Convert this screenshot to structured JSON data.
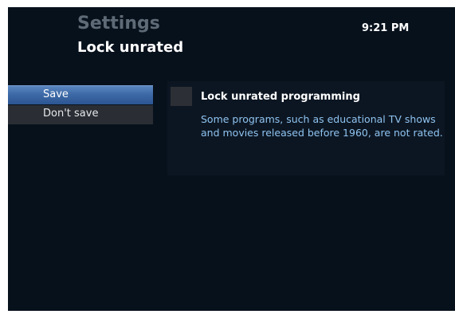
{
  "header": {
    "title": "Settings",
    "subtitle": "Lock unrated",
    "clock": "9:21 PM"
  },
  "menu": {
    "items": [
      {
        "label": "Save",
        "selected": true
      },
      {
        "label": "Don't save",
        "selected": false
      }
    ]
  },
  "option": {
    "label": "Lock unrated programming",
    "checked": false,
    "description_line1": "Some programs, such as educational TV shows",
    "description_line2": "and movies released before 1960, are not rated."
  },
  "colors": {
    "background": "#07111c",
    "accent": "#3d6aa7",
    "description_text": "#8fc3f0"
  }
}
